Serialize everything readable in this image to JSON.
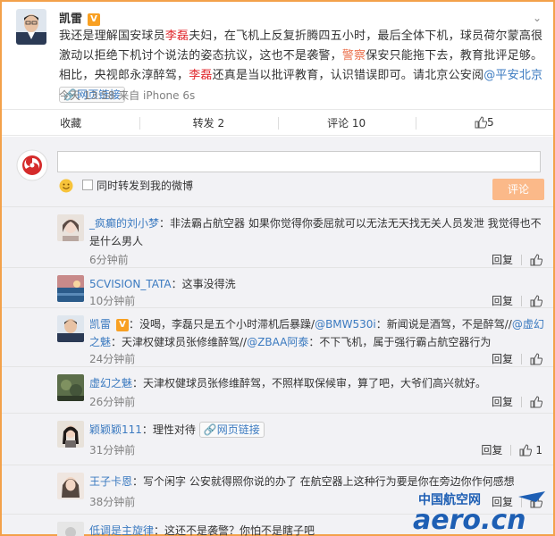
{
  "post": {
    "author": "凯雷",
    "vip_badge": "V",
    "text_parts": {
      "p1": "我还是理解国安球员",
      "name1": "李磊",
      "p2": "夫妇，在飞机上反复折腾四五小时，最后全体下机，球员荷尔蒙高很激动以拒绝下机讨个说法的姿态抗议，这也不是袭警，",
      "jing": "警察",
      "p3": "保安只能拖下去，教育批评足够。相比，央视郎永淳醉驾，",
      "name2": "李磊",
      "p4": "还真是当以批评教育，认识错误即可。请北京公安阅",
      "mention": "@平安北京",
      "weblink": "网页链接"
    },
    "meta": "今天 13:58 来自 iPhone 6s"
  },
  "actions": {
    "favorite": "收藏",
    "repost": "转发 2",
    "comment": "评论 10",
    "like": "5"
  },
  "composer": {
    "repost_label": "同时转发到我的微博",
    "submit": "评论"
  },
  "comments": [
    {
      "name": "_疯癫的刘小梦",
      "text": "：非法霸占航空器 如果你觉得你委屈就可以无法无天找无关人员发泄 我觉得也不是什么男人",
      "time": "6分钟前",
      "reply": "回复",
      "likes": ""
    },
    {
      "name": "5CVISION_TATA",
      "text": "：这事没得洗",
      "time": "10分钟前",
      "reply": "回复",
      "likes": ""
    },
    {
      "name": "凯雷",
      "vip": "V",
      "text_a": "：没喝，李磊只是五个小时滞机后暴躁/",
      "m1": "@BMW530i",
      "text_b": "：新闻说是酒驾，不是醉驾//",
      "m2": "@虚幻之魅",
      "text_c": "：天津权健球员张修维醉驾//",
      "m3": "@ZBAA阿泰",
      "text_d": "：不下飞机，属于强行霸占航空器行为",
      "time": "24分钟前",
      "reply": "回复",
      "likes": ""
    },
    {
      "name": "虚幻之魅",
      "text": "：天津权健球员张修维醉驾，不照样取保候审，算了吧，大爷们高兴就好。",
      "time": "26分钟前",
      "reply": "回复",
      "likes": ""
    },
    {
      "name": "颖颖颖111",
      "text": "：理性对待",
      "weblink": "网页链接",
      "time": "31分钟前",
      "reply": "回复",
      "likes": "1"
    },
    {
      "name": "王子卡恩",
      "text": "：写个闲字 公安就得照你说的办了 在航空器上这种行为要是你在旁边你作何感想",
      "time": "38分钟前",
      "reply": "回复",
      "likes": ""
    },
    {
      "name": "低调是主旋律",
      "text": "：这还不是袭警？你怕不是瞎子吧",
      "time": "",
      "reply": "",
      "likes": ""
    }
  ],
  "watermark": {
    "cn": "中国航空网",
    "en": "aero.cn"
  },
  "colors": {
    "border": "#f3a14a",
    "link": "#3b7ac0",
    "highlight": "#e0262b",
    "button": "#fbb989"
  }
}
